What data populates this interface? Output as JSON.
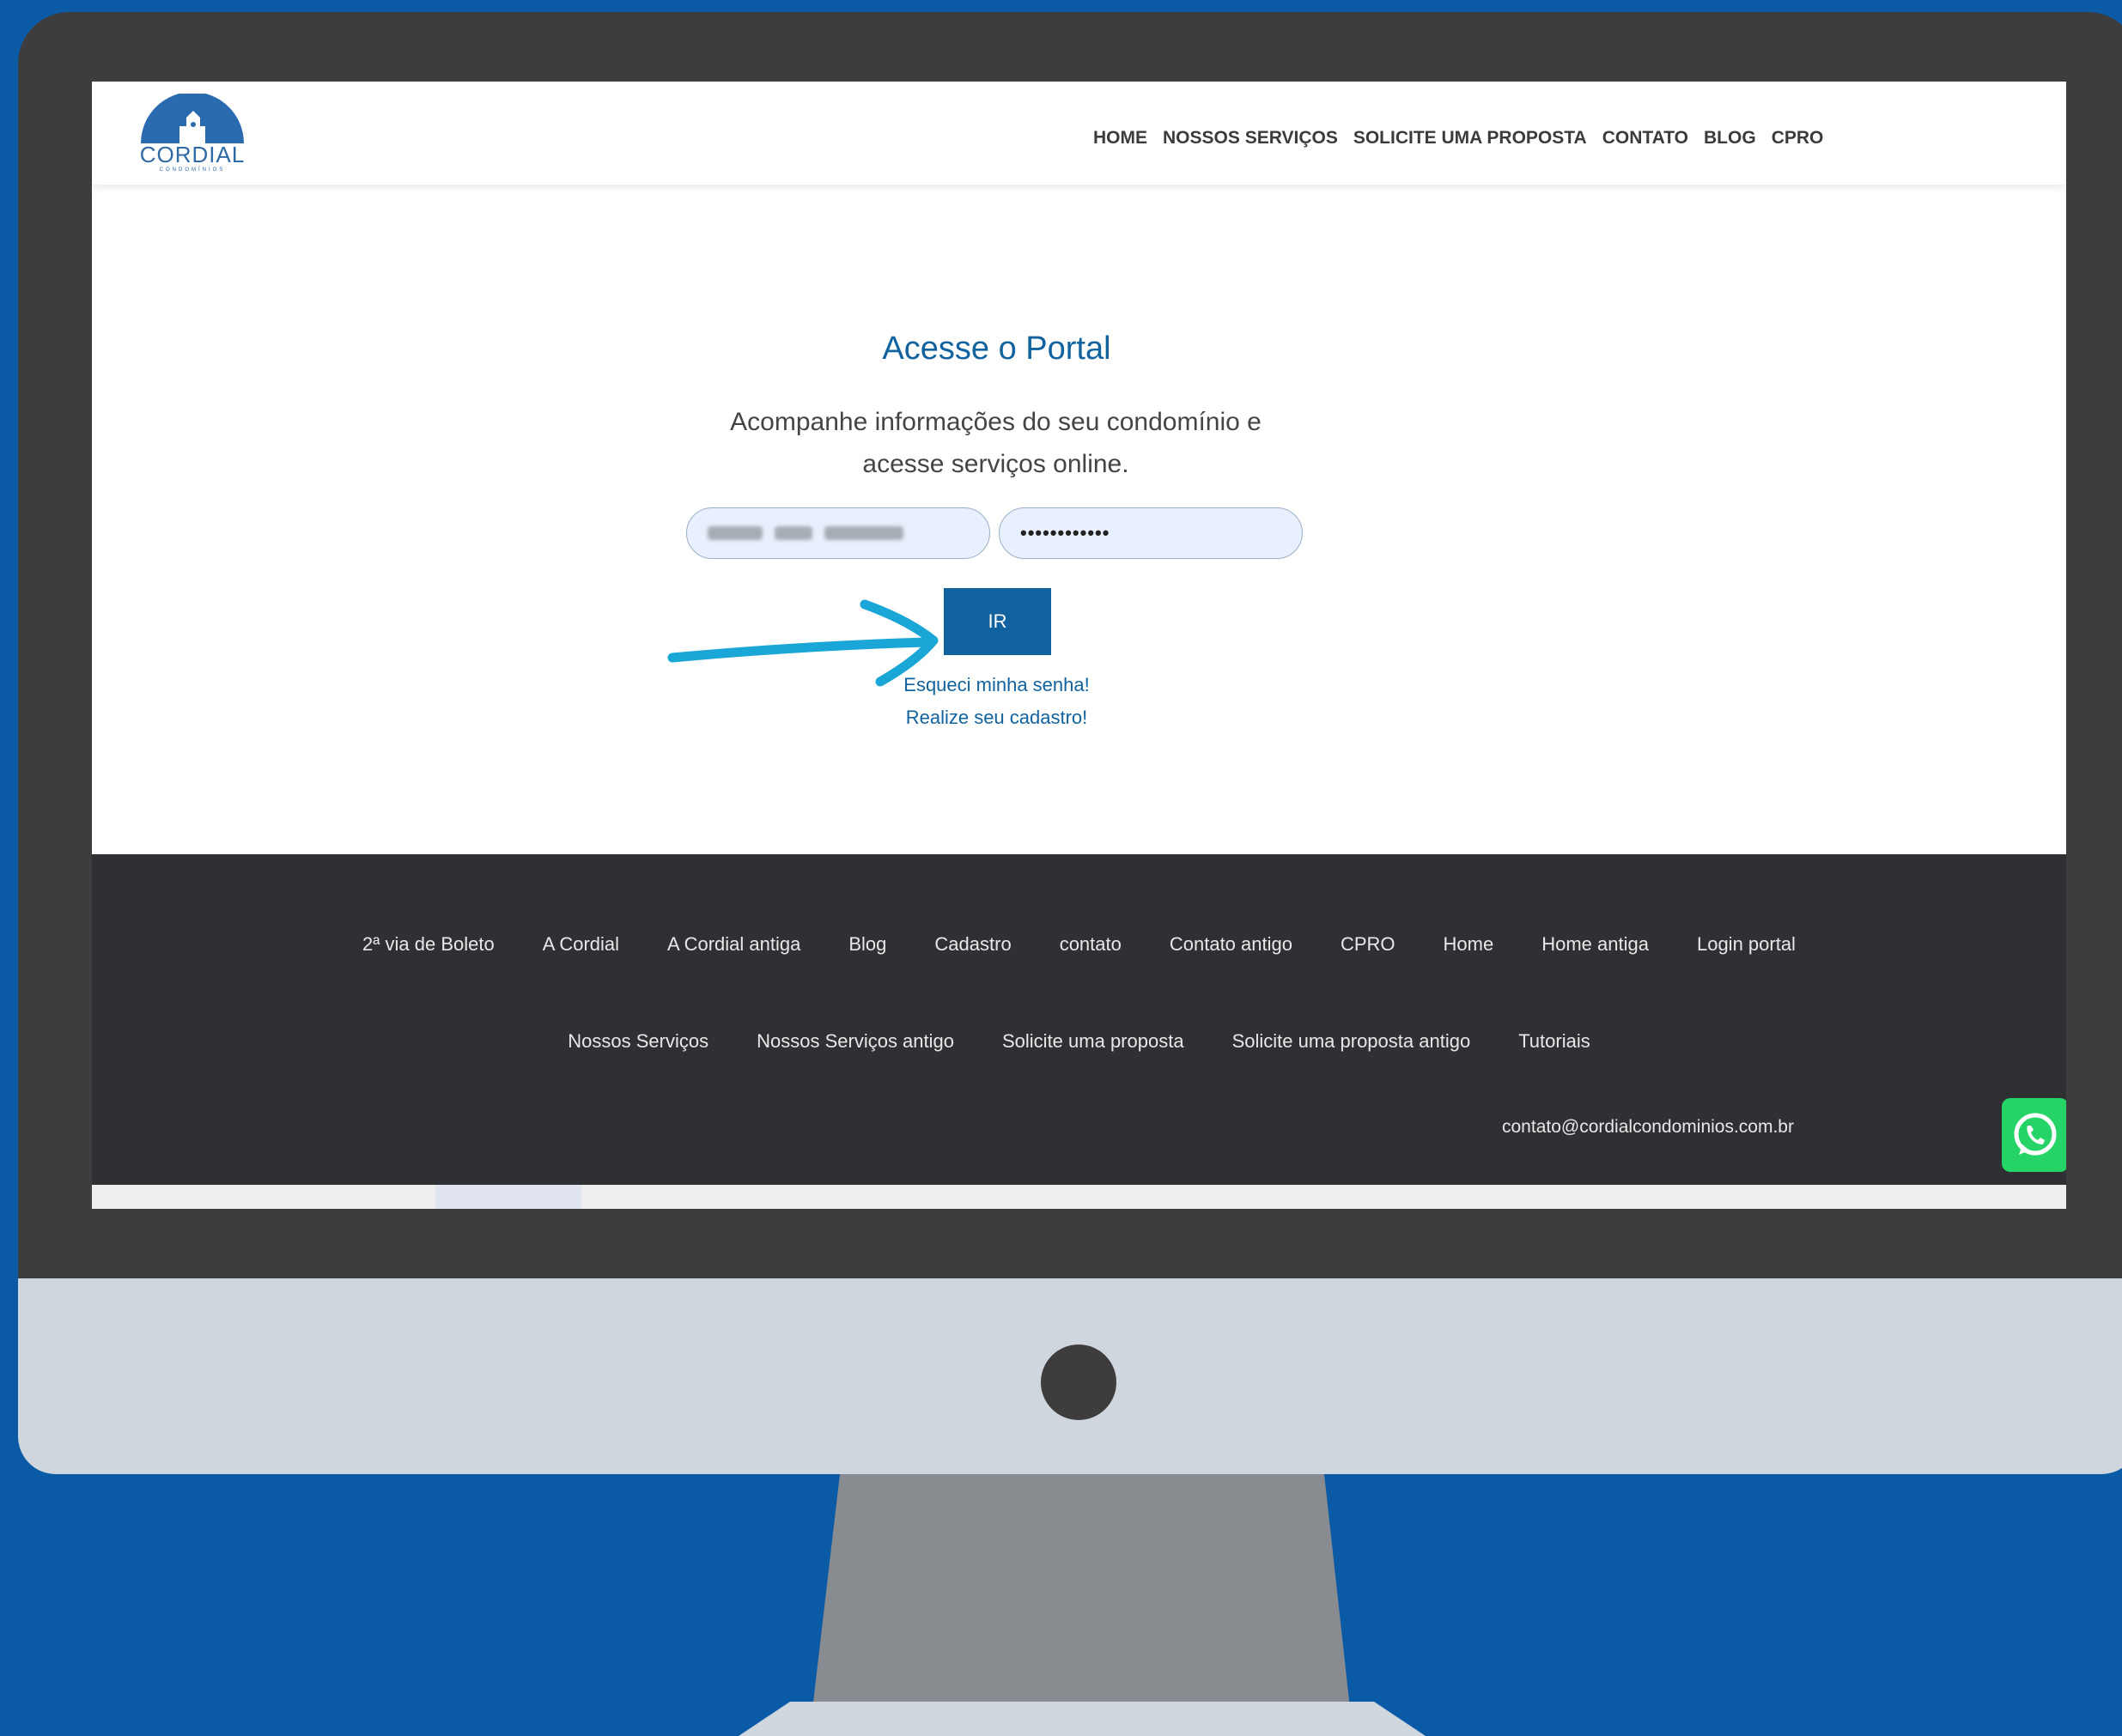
{
  "header": {
    "logo_text": "CORDIAL",
    "logo_subtext": "CONDOMÍNIOS",
    "nav": [
      "HOME",
      "NOSSOS SERVIÇOS",
      "SOLICITE UMA PROPOSTA",
      "CONTATO",
      "BLOG",
      "CPRO"
    ]
  },
  "login": {
    "title": "Acesse o Portal",
    "subtitle": "Acompanhe informações do seu condomínio e acesse serviços online.",
    "password_value": "••••••••••••",
    "submit_label": "IR",
    "forgot_link": "Esqueci minha senha!",
    "register_link": "Realize seu cadastro!"
  },
  "footer": {
    "row1": [
      "2ª via de Boleto",
      "A Cordial",
      "A Cordial antiga",
      "Blog",
      "Cadastro",
      "contato",
      "Contato antigo",
      "CPRO",
      "Home",
      "Home antiga",
      "Login portal"
    ],
    "row2": [
      "Nossos Serviços",
      "Nossos Serviços antigo",
      "Solicite uma proposta",
      "Solicite uma proposta antigo",
      "Tutoriais"
    ],
    "email": "contato@cordialcondominios.com.br"
  },
  "colors": {
    "background": "#0a5aa6",
    "accent": "#11639f",
    "footer": "#2e3033",
    "whatsapp": "#25d366",
    "arrow": "#1aa6d6"
  },
  "icons": {
    "whatsapp": "whatsapp-icon",
    "logo": "cordial-logo-icon",
    "arrow": "annotation-arrow-icon"
  }
}
